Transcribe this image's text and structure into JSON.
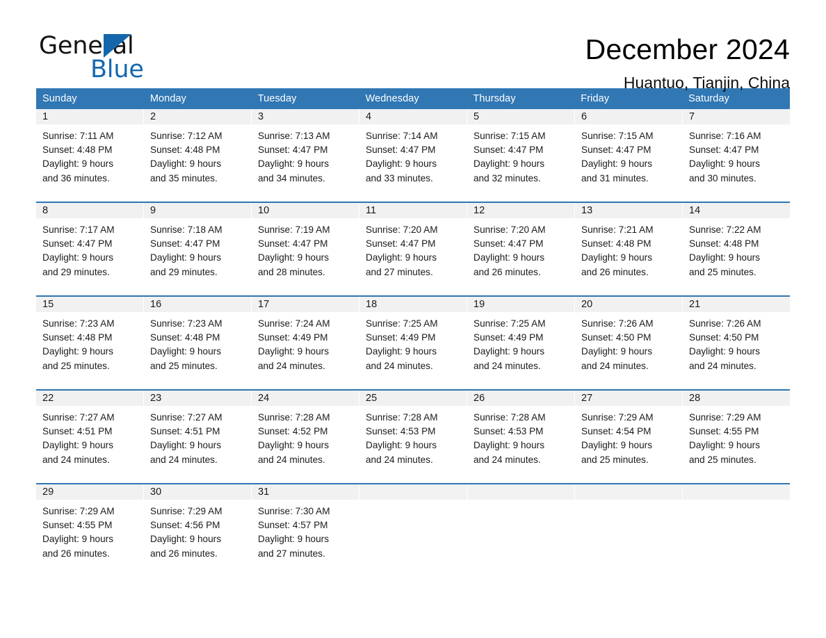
{
  "brand": {
    "name_part1": "General",
    "name_part2": "Blue",
    "logo_icon": "triangle-flag-icon",
    "accent_color": "#1569b0"
  },
  "header": {
    "month_title": "December 2024",
    "location": "Huantuo, Tianjin, China"
  },
  "theme": {
    "header_row_bg": "#3077b4",
    "row_divider": "#2f76b3",
    "daynum_band_bg": "#f1f1f1",
    "page_bg": "#ffffff",
    "text": "#1a1a1a"
  },
  "weekdays": [
    "Sunday",
    "Monday",
    "Tuesday",
    "Wednesday",
    "Thursday",
    "Friday",
    "Saturday"
  ],
  "weeks": [
    [
      {
        "day": "1",
        "lines": [
          "Sunrise: 7:11 AM",
          "Sunset: 4:48 PM",
          "Daylight: 9 hours",
          "and 36 minutes."
        ]
      },
      {
        "day": "2",
        "lines": [
          "Sunrise: 7:12 AM",
          "Sunset: 4:48 PM",
          "Daylight: 9 hours",
          "and 35 minutes."
        ]
      },
      {
        "day": "3",
        "lines": [
          "Sunrise: 7:13 AM",
          "Sunset: 4:47 PM",
          "Daylight: 9 hours",
          "and 34 minutes."
        ]
      },
      {
        "day": "4",
        "lines": [
          "Sunrise: 7:14 AM",
          "Sunset: 4:47 PM",
          "Daylight: 9 hours",
          "and 33 minutes."
        ]
      },
      {
        "day": "5",
        "lines": [
          "Sunrise: 7:15 AM",
          "Sunset: 4:47 PM",
          "Daylight: 9 hours",
          "and 32 minutes."
        ]
      },
      {
        "day": "6",
        "lines": [
          "Sunrise: 7:15 AM",
          "Sunset: 4:47 PM",
          "Daylight: 9 hours",
          "and 31 minutes."
        ]
      },
      {
        "day": "7",
        "lines": [
          "Sunrise: 7:16 AM",
          "Sunset: 4:47 PM",
          "Daylight: 9 hours",
          "and 30 minutes."
        ]
      }
    ],
    [
      {
        "day": "8",
        "lines": [
          "Sunrise: 7:17 AM",
          "Sunset: 4:47 PM",
          "Daylight: 9 hours",
          "and 29 minutes."
        ]
      },
      {
        "day": "9",
        "lines": [
          "Sunrise: 7:18 AM",
          "Sunset: 4:47 PM",
          "Daylight: 9 hours",
          "and 29 minutes."
        ]
      },
      {
        "day": "10",
        "lines": [
          "Sunrise: 7:19 AM",
          "Sunset: 4:47 PM",
          "Daylight: 9 hours",
          "and 28 minutes."
        ]
      },
      {
        "day": "11",
        "lines": [
          "Sunrise: 7:20 AM",
          "Sunset: 4:47 PM",
          "Daylight: 9 hours",
          "and 27 minutes."
        ]
      },
      {
        "day": "12",
        "lines": [
          "Sunrise: 7:20 AM",
          "Sunset: 4:47 PM",
          "Daylight: 9 hours",
          "and 26 minutes."
        ]
      },
      {
        "day": "13",
        "lines": [
          "Sunrise: 7:21 AM",
          "Sunset: 4:48 PM",
          "Daylight: 9 hours",
          "and 26 minutes."
        ]
      },
      {
        "day": "14",
        "lines": [
          "Sunrise: 7:22 AM",
          "Sunset: 4:48 PM",
          "Daylight: 9 hours",
          "and 25 minutes."
        ]
      }
    ],
    [
      {
        "day": "15",
        "lines": [
          "Sunrise: 7:23 AM",
          "Sunset: 4:48 PM",
          "Daylight: 9 hours",
          "and 25 minutes."
        ]
      },
      {
        "day": "16",
        "lines": [
          "Sunrise: 7:23 AM",
          "Sunset: 4:48 PM",
          "Daylight: 9 hours",
          "and 25 minutes."
        ]
      },
      {
        "day": "17",
        "lines": [
          "Sunrise: 7:24 AM",
          "Sunset: 4:49 PM",
          "Daylight: 9 hours",
          "and 24 minutes."
        ]
      },
      {
        "day": "18",
        "lines": [
          "Sunrise: 7:25 AM",
          "Sunset: 4:49 PM",
          "Daylight: 9 hours",
          "and 24 minutes."
        ]
      },
      {
        "day": "19",
        "lines": [
          "Sunrise: 7:25 AM",
          "Sunset: 4:49 PM",
          "Daylight: 9 hours",
          "and 24 minutes."
        ]
      },
      {
        "day": "20",
        "lines": [
          "Sunrise: 7:26 AM",
          "Sunset: 4:50 PM",
          "Daylight: 9 hours",
          "and 24 minutes."
        ]
      },
      {
        "day": "21",
        "lines": [
          "Sunrise: 7:26 AM",
          "Sunset: 4:50 PM",
          "Daylight: 9 hours",
          "and 24 minutes."
        ]
      }
    ],
    [
      {
        "day": "22",
        "lines": [
          "Sunrise: 7:27 AM",
          "Sunset: 4:51 PM",
          "Daylight: 9 hours",
          "and 24 minutes."
        ]
      },
      {
        "day": "23",
        "lines": [
          "Sunrise: 7:27 AM",
          "Sunset: 4:51 PM",
          "Daylight: 9 hours",
          "and 24 minutes."
        ]
      },
      {
        "day": "24",
        "lines": [
          "Sunrise: 7:28 AM",
          "Sunset: 4:52 PM",
          "Daylight: 9 hours",
          "and 24 minutes."
        ]
      },
      {
        "day": "25",
        "lines": [
          "Sunrise: 7:28 AM",
          "Sunset: 4:53 PM",
          "Daylight: 9 hours",
          "and 24 minutes."
        ]
      },
      {
        "day": "26",
        "lines": [
          "Sunrise: 7:28 AM",
          "Sunset: 4:53 PM",
          "Daylight: 9 hours",
          "and 24 minutes."
        ]
      },
      {
        "day": "27",
        "lines": [
          "Sunrise: 7:29 AM",
          "Sunset: 4:54 PM",
          "Daylight: 9 hours",
          "and 25 minutes."
        ]
      },
      {
        "day": "28",
        "lines": [
          "Sunrise: 7:29 AM",
          "Sunset: 4:55 PM",
          "Daylight: 9 hours",
          "and 25 minutes."
        ]
      }
    ],
    [
      {
        "day": "29",
        "lines": [
          "Sunrise: 7:29 AM",
          "Sunset: 4:55 PM",
          "Daylight: 9 hours",
          "and 26 minutes."
        ]
      },
      {
        "day": "30",
        "lines": [
          "Sunrise: 7:29 AM",
          "Sunset: 4:56 PM",
          "Daylight: 9 hours",
          "and 26 minutes."
        ]
      },
      {
        "day": "31",
        "lines": [
          "Sunrise: 7:30 AM",
          "Sunset: 4:57 PM",
          "Daylight: 9 hours",
          "and 27 minutes."
        ]
      },
      {
        "day": "",
        "lines": []
      },
      {
        "day": "",
        "lines": []
      },
      {
        "day": "",
        "lines": []
      },
      {
        "day": "",
        "lines": []
      }
    ]
  ]
}
